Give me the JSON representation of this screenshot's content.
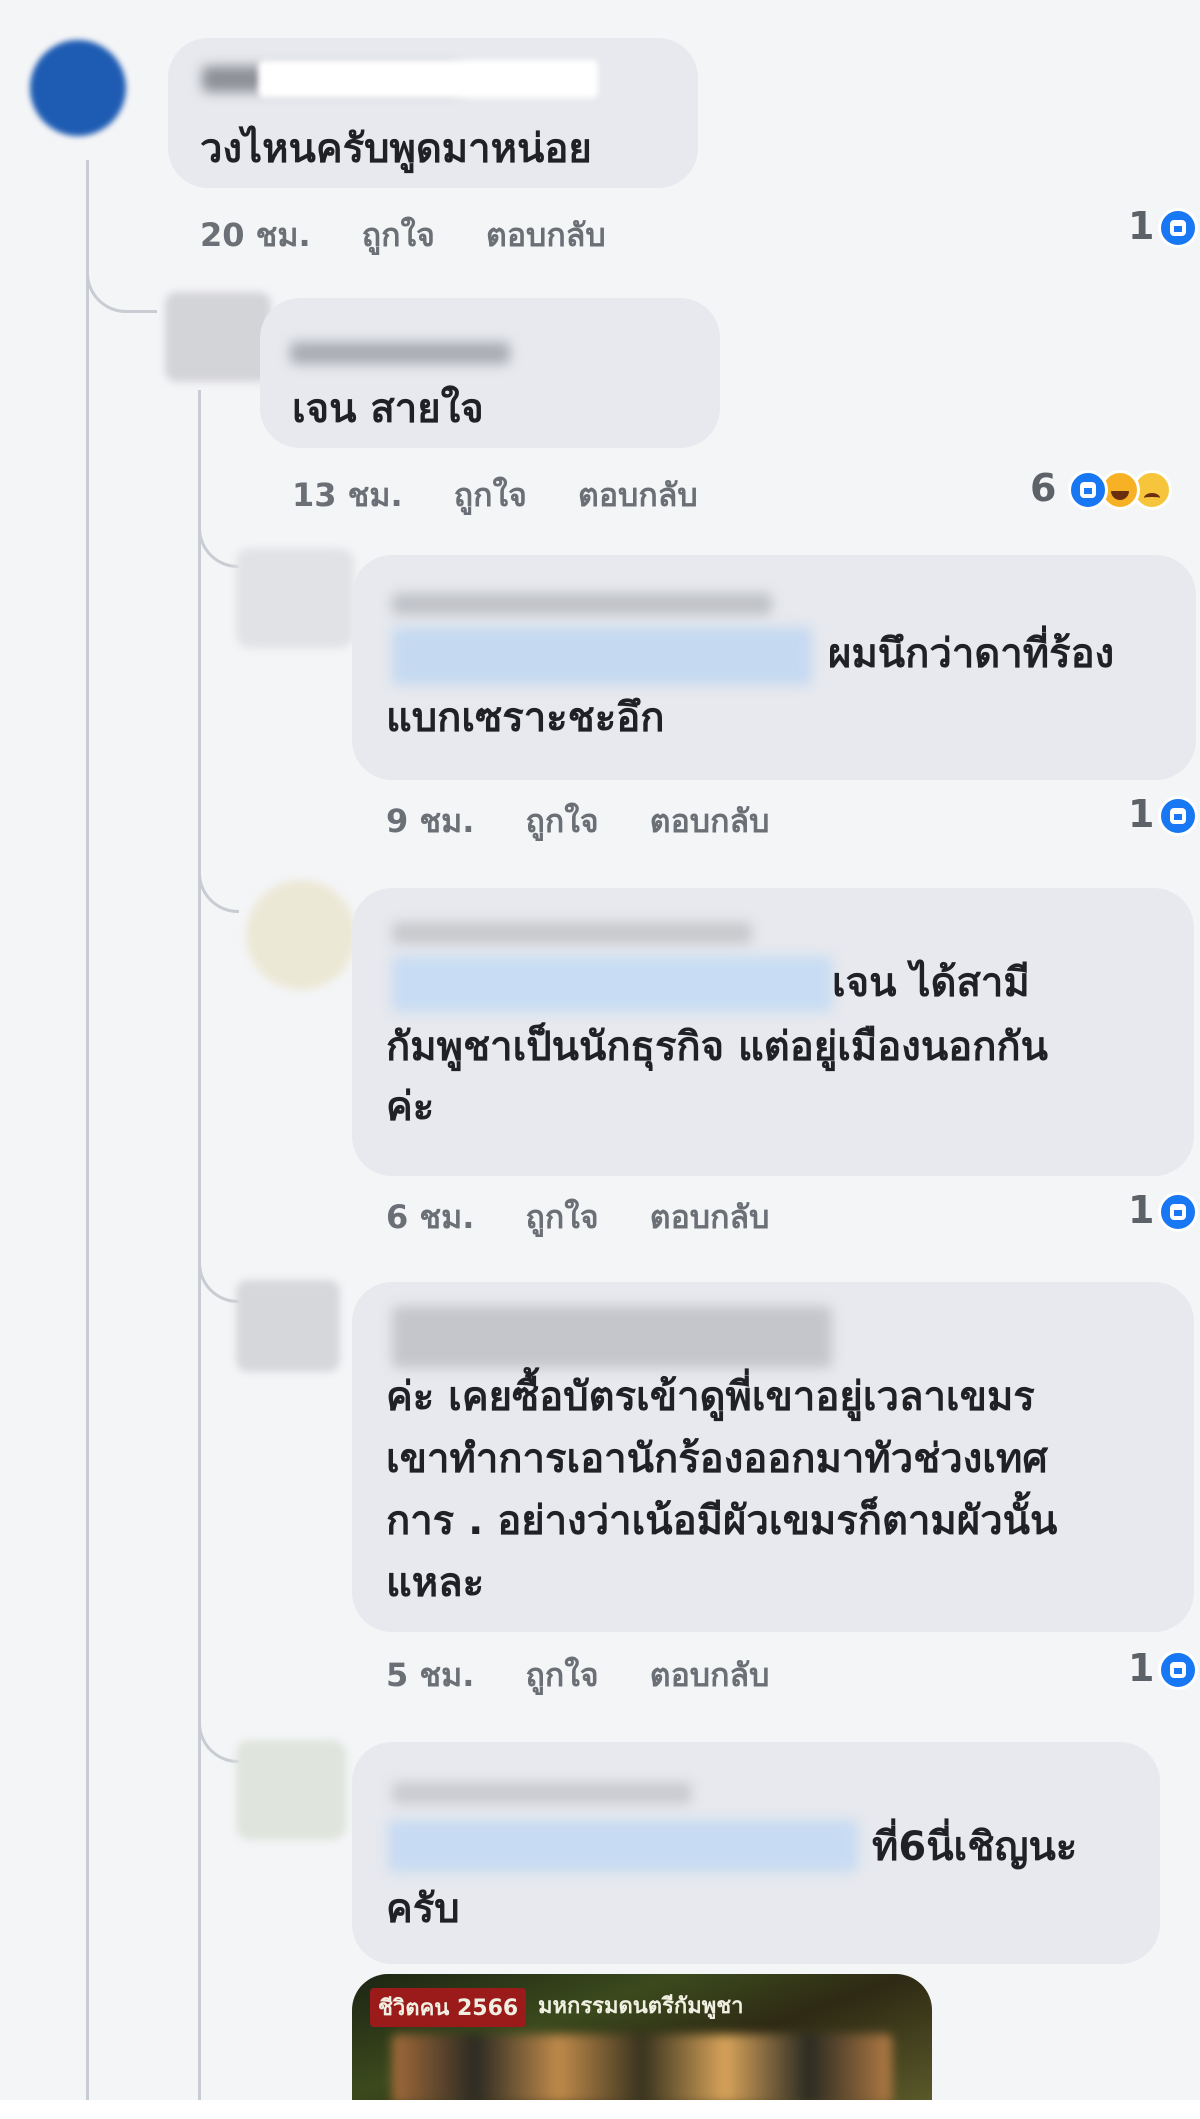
{
  "comments": [
    {
      "text_lines": [
        "วงไหนครับพูดมาหน่อย"
      ],
      "time": "20 ชม.",
      "like": "ถูกใจ",
      "reply": "ตอบกลับ",
      "reaction_count": "1",
      "reactions": [
        "like-icon"
      ]
    },
    {
      "text_lines": [
        "เจน สายใจ"
      ],
      "time": "13 ชม.",
      "like": "ถูกใจ",
      "reply": "ตอบกลับ",
      "reaction_count": "6",
      "reactions": [
        "like-icon",
        "haha-icon",
        "sad-icon"
      ]
    },
    {
      "text_lines": [
        "ผมนึกว่าดาที่ร้อง",
        "แบกเซราะชะอึก"
      ],
      "time": "9 ชม.",
      "like": "ถูกใจ",
      "reply": "ตอบกลับ",
      "reaction_count": "1",
      "reactions": [
        "like-icon"
      ]
    },
    {
      "text_lines": [
        "เจน ได้สามี",
        "กัมพูชาเป็นนักธุรกิจ แต่อยู่เมืองนอกกัน",
        "ค่ะ"
      ],
      "time": "6 ชม.",
      "like": "ถูกใจ",
      "reply": "ตอบกลับ",
      "reaction_count": "1",
      "reactions": [
        "like-icon"
      ]
    },
    {
      "text_lines": [
        "ค่ะ เคยซื้อบัตรเข้าดูพี่เขาอยู่เวลาเขมร",
        "เขาทำการเอานักร้องออกมาทัวช่วงเทศ",
        "การ . อย่างว่าเน้อมีผัวเขมรก็ตามผัวนั้น",
        "แหละ"
      ],
      "time": "5 ชม.",
      "like": "ถูกใจ",
      "reply": "ตอบกลับ",
      "reaction_count": "1",
      "reactions": [
        "like-icon"
      ]
    },
    {
      "text_lines": [
        "ที่6นี่เชิญนะ",
        "ครับ"
      ]
    }
  ],
  "attachment": {
    "badge": "ชีวิตคน 2566",
    "caption": "มหกรรมดนตรีกัมพูชา"
  },
  "colors": {
    "bubble": "#e7e9ee",
    "like_blue": "#1877f2",
    "meta_gray": "#6b6f76"
  }
}
